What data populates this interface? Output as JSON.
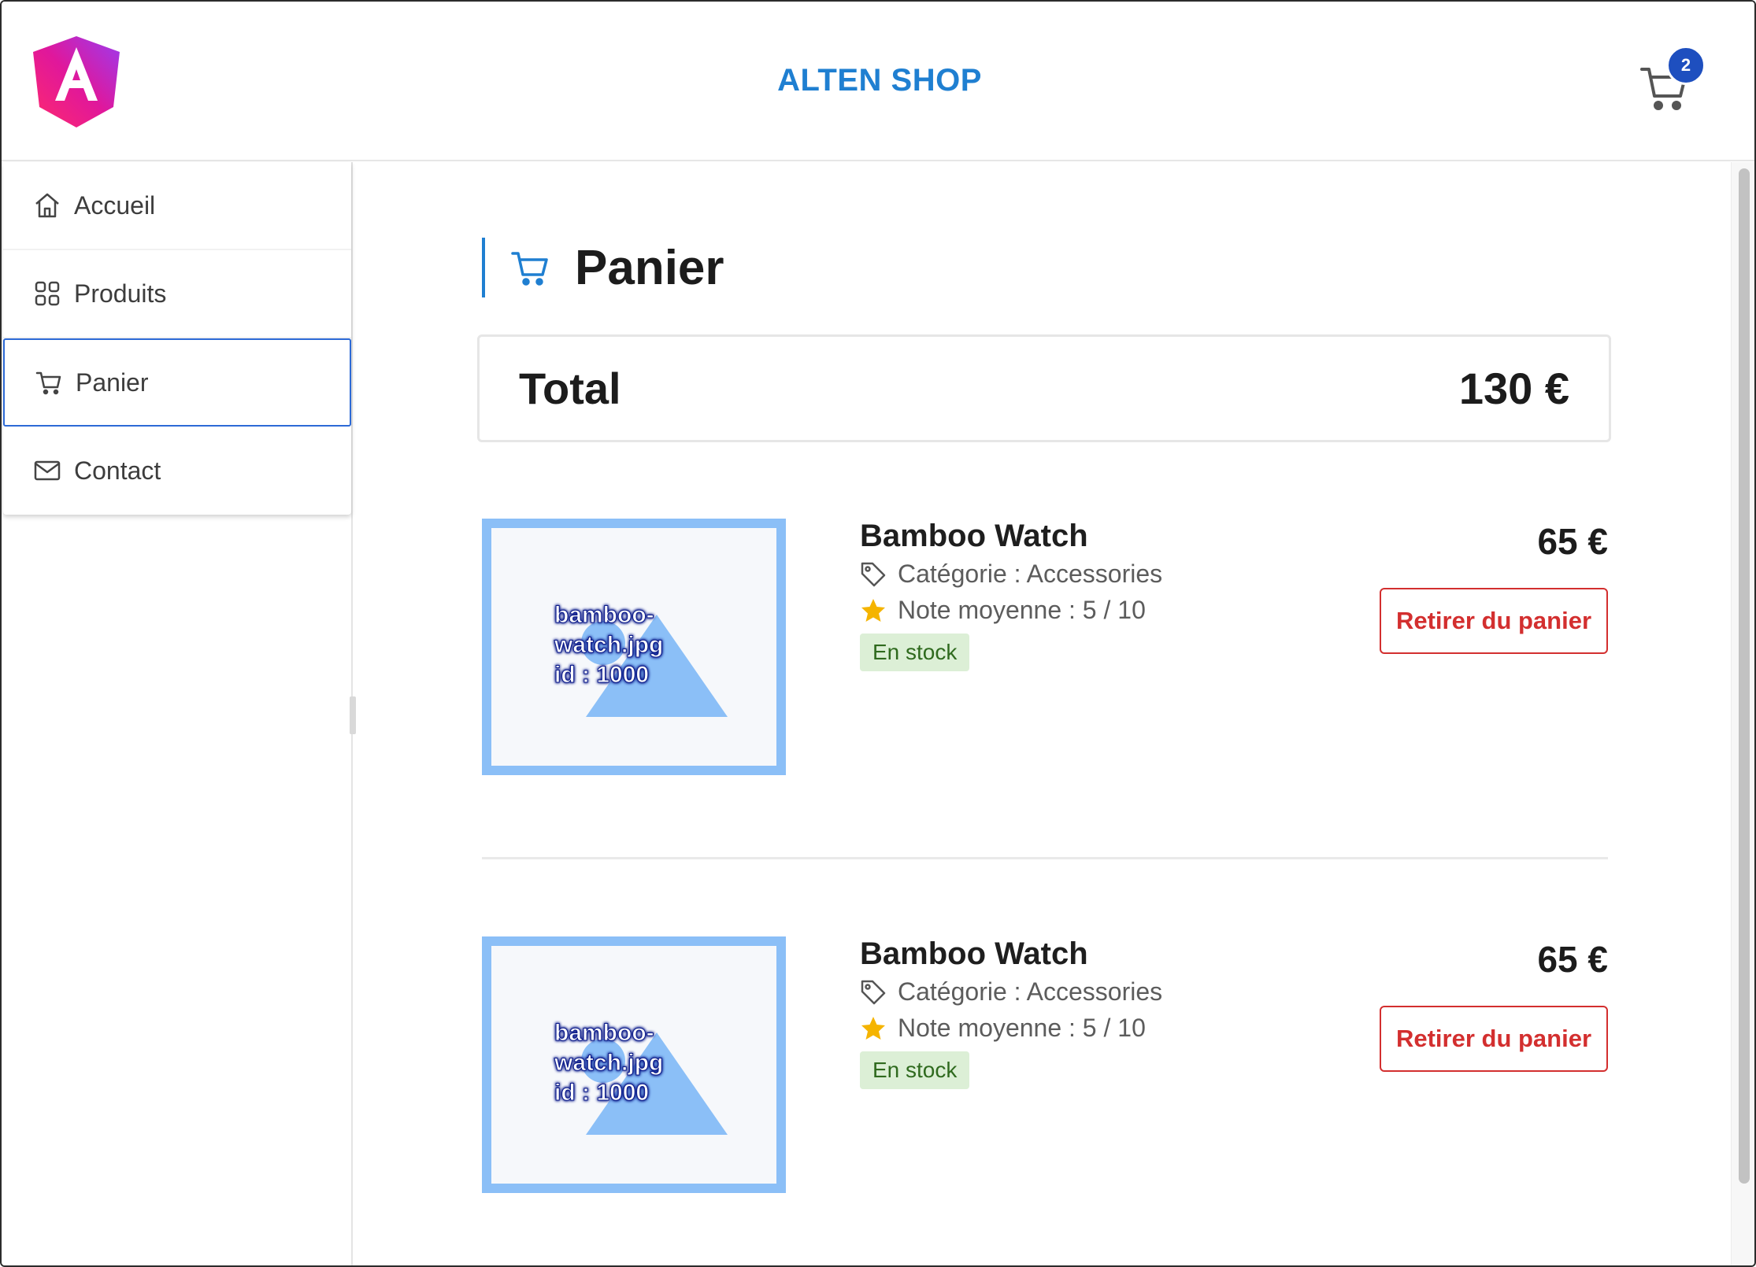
{
  "header": {
    "title": "ALTEN SHOP",
    "cart_count": "2"
  },
  "sidebar": {
    "items": [
      {
        "label": "Accueil",
        "icon": "home-icon"
      },
      {
        "label": "Produits",
        "icon": "grid-icon"
      },
      {
        "label": "Panier",
        "icon": "cart-icon",
        "active": true
      },
      {
        "label": "Contact",
        "icon": "envelope-icon"
      }
    ]
  },
  "main": {
    "heading": "Panier",
    "total_label": "Total",
    "total_value": "130 €",
    "products": [
      {
        "name": "Bamboo Watch",
        "category": "Catégorie : Accessories",
        "rating": "Note moyenne : 5 / 10",
        "stock": "En stock",
        "price": "65 €",
        "remove_label": "Retirer du panier",
        "image_text": "bamboo-\nwatch.jpg\nid : 1000"
      },
      {
        "name": "Bamboo Watch",
        "category": "Catégorie : Accessories",
        "rating": "Note moyenne : 5 / 10",
        "stock": "En stock",
        "price": "65 €",
        "remove_label": "Retirer du panier",
        "image_text": "bamboo-\nwatch.jpg\nid : 1000"
      }
    ]
  },
  "colors": {
    "accent": "#1f7fd1",
    "badge": "#1e4fbf",
    "danger": "#d32f2f",
    "stock_bg": "#dcefd6",
    "stock_text": "#2f6a1e",
    "star": "#f5b400"
  }
}
